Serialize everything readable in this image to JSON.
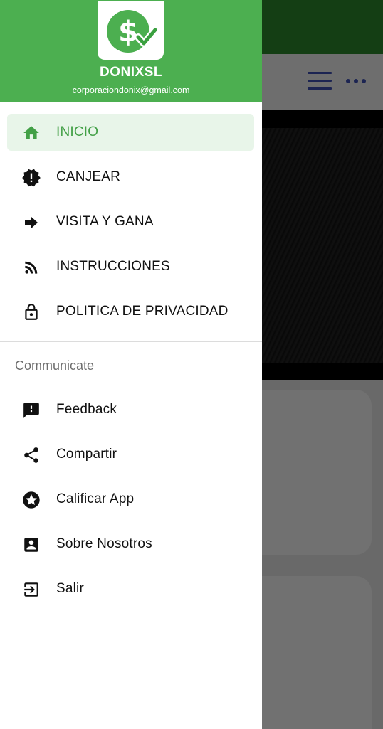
{
  "app": {
    "name": "DONIXSL",
    "email": "corporaciondonix@gmail.com"
  },
  "colors": {
    "brand_green": "#4caf50",
    "active_text": "#43a047",
    "active_bg": "#e8f5e9",
    "toolbar_icon": "#3f51b5"
  },
  "main_menu": [
    {
      "label": "INICIO",
      "icon": "home-icon",
      "active": true
    },
    {
      "label": "CANJEAR",
      "icon": "alert-badge-icon"
    },
    {
      "label": "VISITA Y GANA",
      "icon": "arrow-right-icon"
    },
    {
      "label": "INSTRUCCIONES",
      "icon": "rss-feed-icon"
    },
    {
      "label": "POLITICA DE PRIVACIDAD",
      "icon": "lock-icon"
    }
  ],
  "communicate": {
    "title": "Communicate",
    "items": [
      {
        "label": "Feedback",
        "icon": "feedback-icon"
      },
      {
        "label": "Compartir",
        "icon": "share-icon"
      },
      {
        "label": "Calificar App",
        "icon": "star-circle-icon"
      },
      {
        "label": "Sobre Nosotros",
        "icon": "account-box-icon"
      },
      {
        "label": "Salir",
        "icon": "exit-icon"
      }
    ]
  }
}
